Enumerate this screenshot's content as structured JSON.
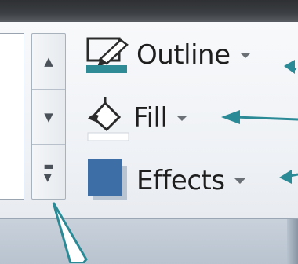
{
  "ribbon": {
    "commands": [
      {
        "label": "Outline",
        "icon": "pen-outline-icon"
      },
      {
        "label": "Fill",
        "icon": "paint-bucket-icon"
      },
      {
        "label": "Effects",
        "icon": "effects-square-icon"
      }
    ],
    "gallery_scroll": [
      "scroll-up-icon",
      "scroll-down-icon",
      "gallery-more-icon"
    ]
  },
  "colors": {
    "outline_swatch": "#2f8c97",
    "effects_square": "#3e6ea6",
    "callout_arrow": "#2a8a96"
  }
}
